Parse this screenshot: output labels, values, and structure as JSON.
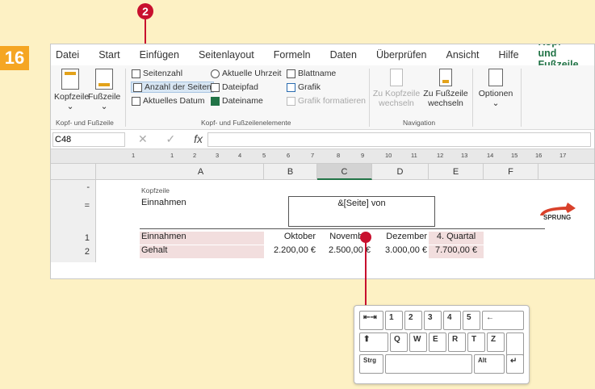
{
  "step": "16",
  "callout": "2",
  "tabs": [
    "Datei",
    "Start",
    "Einfügen",
    "Seitenlayout",
    "Formeln",
    "Daten",
    "Überprüfen",
    "Ansicht",
    "Hilfe",
    "Kopf- und Fußzeile"
  ],
  "ribbon": {
    "kopfzeile": "Kopfzeile",
    "fusszeile": "Fußzeile",
    "group1_label": "Kopf- und Fußzeile",
    "seitenzahl": "Seitenzahl",
    "anzahl": "Anzahl der Seiten",
    "datum": "Aktuelles Datum",
    "uhrzeit": "Aktuelle Uhrzeit",
    "dateipfad": "Dateipfad",
    "dateiname": "Dateiname",
    "blattname": "Blattname",
    "grafik": "Grafik",
    "grafik_format": "Grafik formatieren",
    "group2_label": "Kopf- und Fußzeilenelemente",
    "zu_kopf_1": "Zu Kopfzeile",
    "zu_kopf_2": "wechseln",
    "zu_fuss_1": "Zu Fußzeile",
    "zu_fuss_2": "wechseln",
    "group3_label": "Navigation",
    "optionen": "Optionen",
    "chevron": "⌄"
  },
  "formula_bar": {
    "namebox": "C48",
    "cancel": "✕",
    "enter": "✓",
    "fx": "fx"
  },
  "ruler_ticks": [
    "1",
    "1",
    "2",
    "3",
    "4",
    "5",
    "6",
    "7",
    "8",
    "9",
    "10",
    "11",
    "12",
    "13",
    "14",
    "15",
    "16",
    "17"
  ],
  "columns": [
    "A",
    "B",
    "C",
    "D",
    "E",
    "F"
  ],
  "header_area": {
    "label": "Kopfzeile",
    "left": "Einnahmen",
    "center": "&[Seite] von"
  },
  "sprung": "SPRUNG",
  "rows": [
    {
      "num": "1",
      "cells": [
        "Einnahmen",
        "Oktober",
        "November",
        "Dezember",
        "4. Quartal"
      ]
    },
    {
      "num": "2",
      "cells": [
        "Gehalt",
        "2.200,00 €",
        "2.500,00 €",
        "3.000,00 €",
        "7.700,00 €"
      ]
    }
  ],
  "keyboard": {
    "tab": "⇤⇥",
    "row1": [
      "1",
      "2",
      "3",
      "4",
      "5"
    ],
    "back": "←",
    "shift": "⬆",
    "row2": [
      "Q",
      "W",
      "E",
      "R",
      "T",
      "Z"
    ],
    "ctrl": "Strg",
    "alt": "Alt",
    "enter": "↵"
  }
}
